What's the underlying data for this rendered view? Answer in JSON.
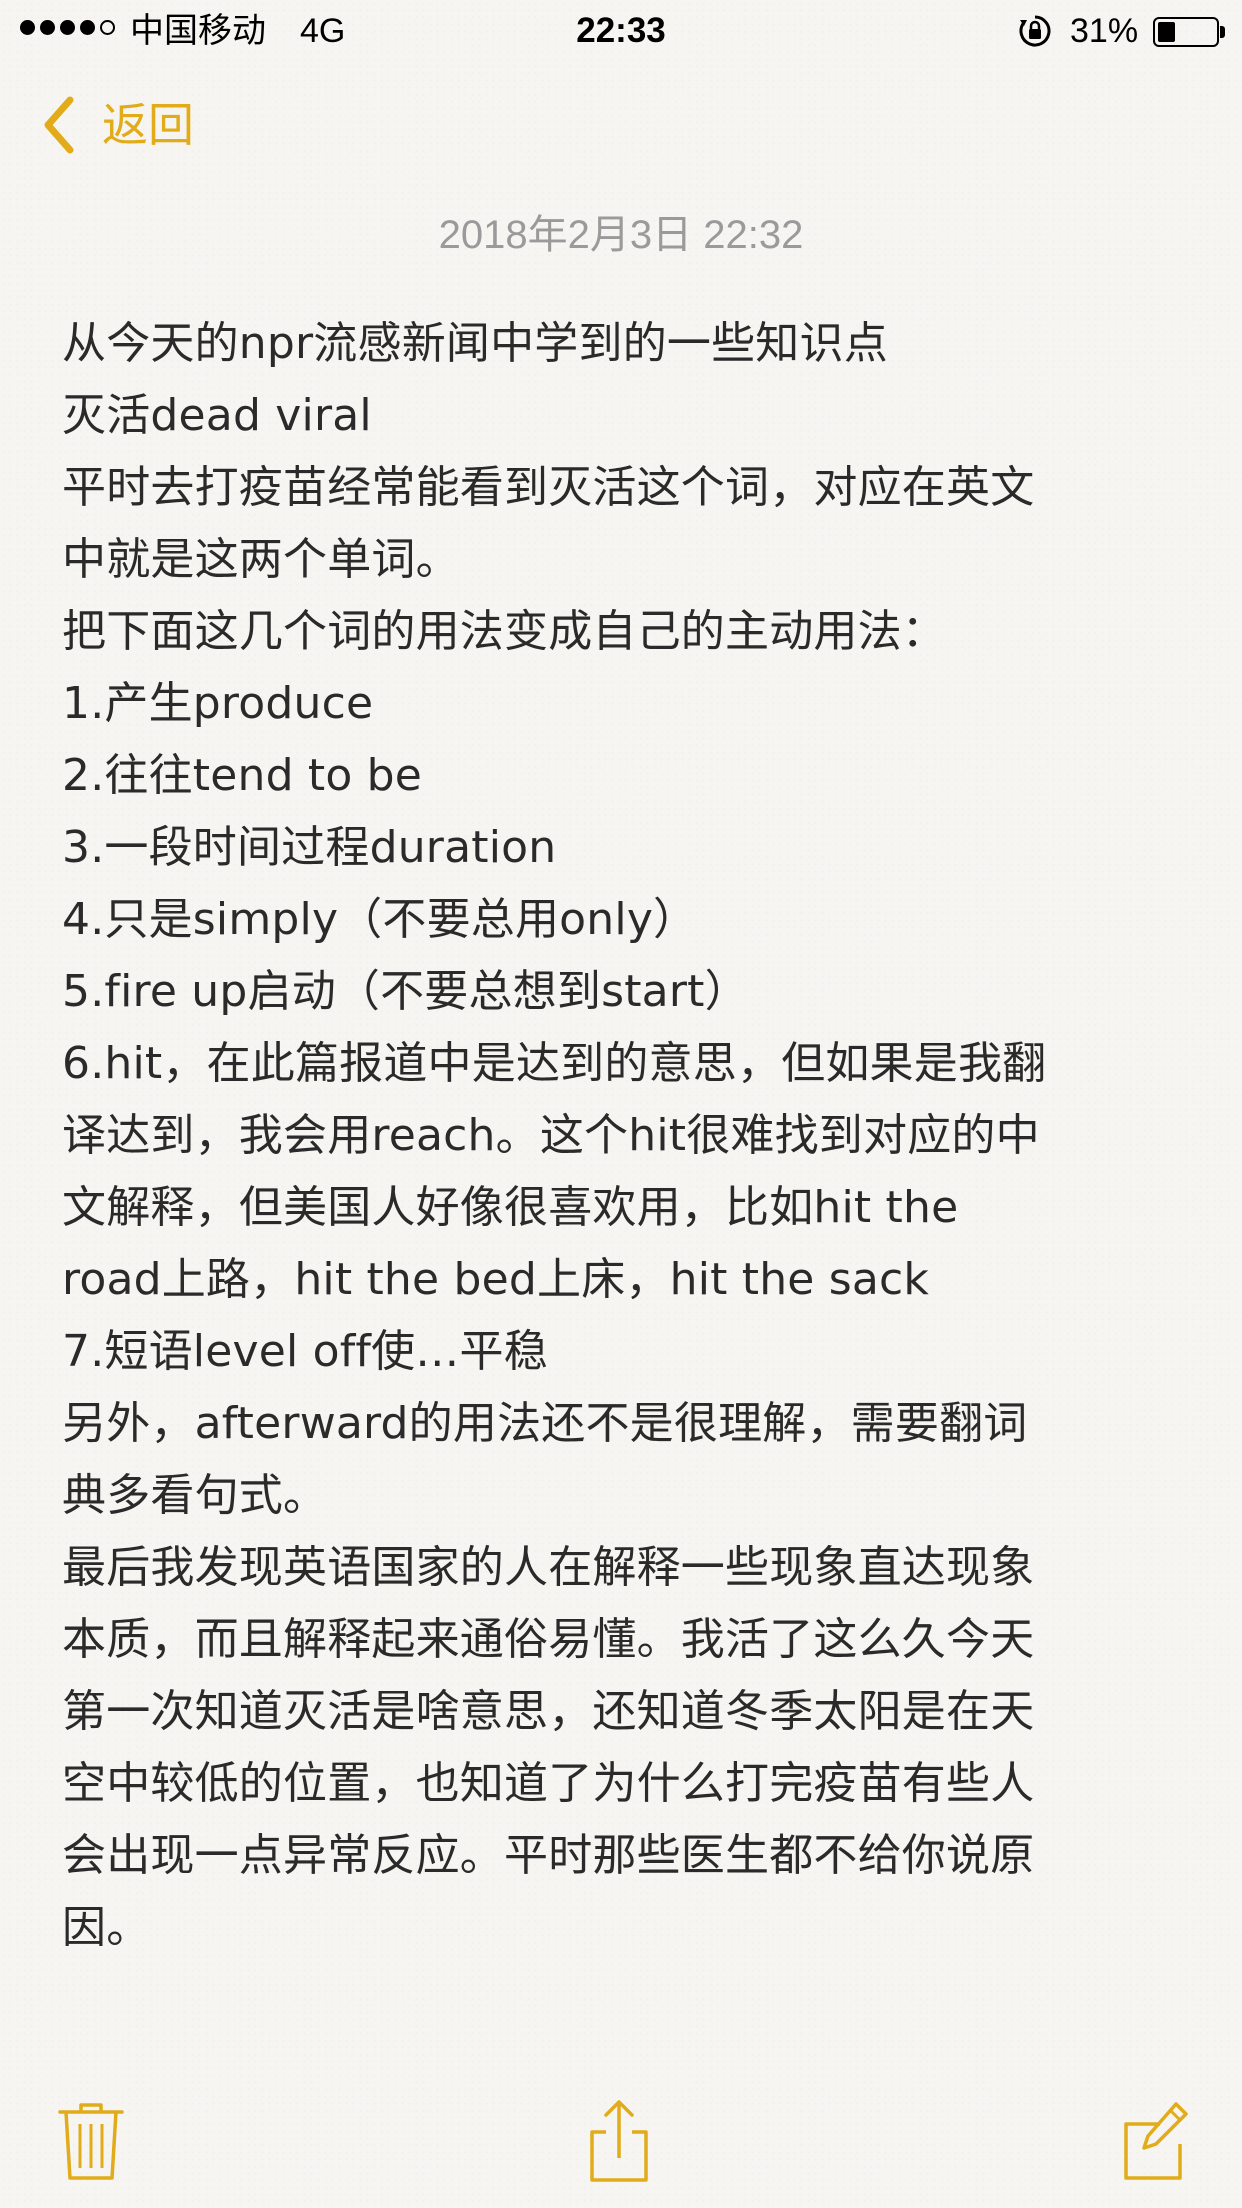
{
  "status_bar": {
    "carrier": "中国移动",
    "network": "4G",
    "time": "22:33",
    "battery_percent_text": "31%",
    "battery_level": 0.31,
    "signal_strength_of_5": 4
  },
  "nav": {
    "back_label": "返回"
  },
  "note": {
    "date": "2018年2月3日 22:32",
    "lines": [
      "从今天的npr流感新闻中学到的一些知识点",
      "灭活dead viral",
      "平时去打疫苗经常能看到灭活这个词，对应在英文",
      "中就是这两个单词。",
      "把下面这几个词的用法变成自己的主动用法：",
      "1.产生produce",
      "2.往往tend to be",
      "3.一段时间过程duration",
      "4.只是simply（不要总用only）",
      "5.fire up启动（不要总想到start）",
      "6.hit，在此篇报道中是达到的意思，但如果是我翻",
      "译达到，我会用reach。这个hit很难找到对应的中",
      "文解释，但美国人好像很喜欢用，比如hit the",
      "road上路，hit the bed上床，hit the sack",
      "7.短语level off使…平稳",
      "另外，afterward的用法还不是很理解，需要翻词",
      "典多看句式。",
      "最后我发现英语国家的人在解释一些现象直达现象",
      "本质，而且解释起来通俗易懂。我活了这么久今天",
      "第一次知道灭活是啥意思，还知道冬季太阳是在天",
      "空中较低的位置，也知道了为什么打完疫苗有些人",
      "会出现一点异常反应。平时那些医生都不给你说原",
      "因。"
    ]
  },
  "toolbar": {
    "icons": [
      "trash-icon",
      "share-icon",
      "compose-icon"
    ]
  },
  "colors": {
    "accent": "#e1ab19",
    "date_text": "#9a9a9a",
    "body_text": "#2a2a2a",
    "background": "#f6f5f2"
  }
}
